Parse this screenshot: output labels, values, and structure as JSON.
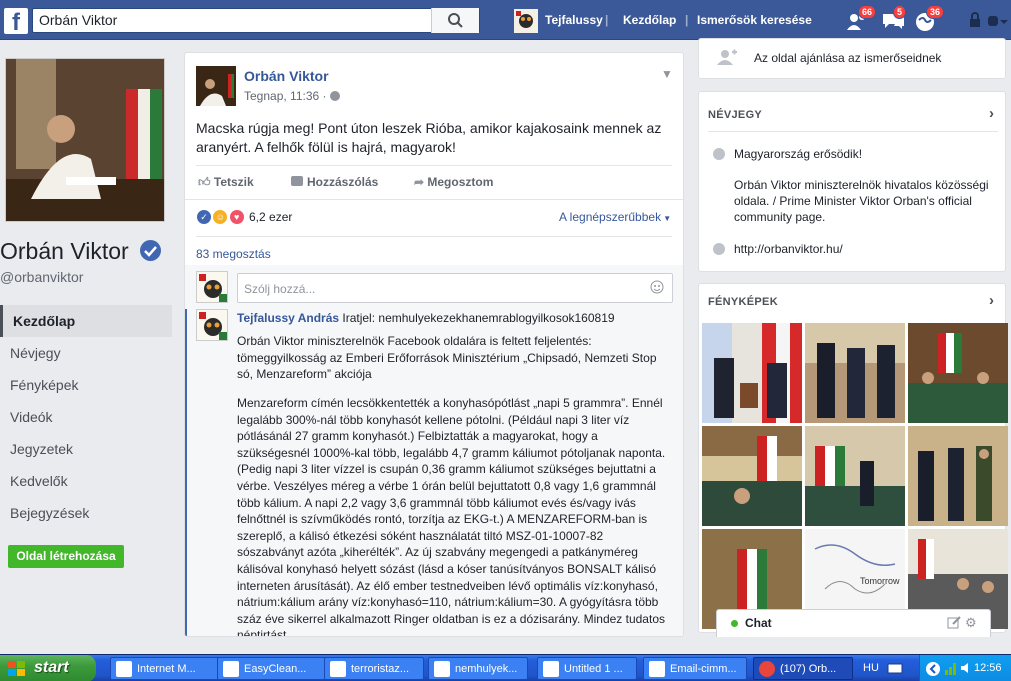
{
  "topbar": {
    "logo": "f",
    "search_value": "Orbán Viktor",
    "user_name": "Tejfalussy",
    "home": "Kezdőlap",
    "find_friends": "Ismerősök keresése",
    "friend_requests_count": "66",
    "messages_count": "5",
    "notifications_count": "36"
  },
  "profile": {
    "name": "Orbán Viktor",
    "handle": "@orbanviktor",
    "nav": [
      "Kezdőlap",
      "Névjegy",
      "Fényképek",
      "Videók",
      "Jegyzetek",
      "Kedvelők",
      "Bejegyzések"
    ],
    "create_page": "Oldal létrehozása"
  },
  "post": {
    "author": "Orbán Viktor",
    "time": "Tegnap, 11:36 · ",
    "text": "Macska rúgja meg! Pont úton leszek Rióba, amikor kajakosaink mennek az aranyért. A felhők fölül is hajrá, magyarok!",
    "actions": {
      "like": "Tetszik",
      "comment": "Hozzászólás",
      "share": "Megosztom"
    },
    "reaction_count": "6,2 ezer",
    "sort": "A legnépszerűbbek",
    "shares": "83 megosztás",
    "comment_placeholder": "Szólj hozzá...",
    "comment": {
      "author": "Tejfalussy András",
      "title": " Iratjel: nemhulyekezekhanemrablogyilkosok160819",
      "para1": "Orbán Viktor miniszterelnök Facebook oldalára is feltett feljelentés: tömeggyilkosság az Emberi Erőforrások Minisztérium „Chipsadó, Nemzeti Stop só, Menzareform” akciója",
      "para2": "Menzareform címén lecsökkentették a konyhasópótlást „napi 5 grammra”. Ennél legalább 300%-nál több konyhasót kellene pótolni. (Például napi 3 liter víz pótlásánál 27 gramm konyhasót.) Felbiztatták a magyarokat, hogy a szükségesnél 1000%-kal több, legalább 4,7 gramm káliumot pótoljanak naponta. (Pedig napi 3 liter vízzel is csupán 0,36 gramm káliumot szükséges bejuttatni a vérbe. Veszélyes méreg a vérbe 1 órán belül bejuttatott 0,8 vagy 1,6 grammnál több kálium. A napi 2,2 vagy 3,6 grammnál több káliumot evés és/vagy ivás felnőttnél is szívműködés rontó, torzítja az EKG-t.) A MENZAREFORM-ban is szereplő, a kálisó étkezési sóként használatát tiltó MSZ-01-10007-82 sószabványt azóta „kiherélték”. Az új szabvány megengedi a patkányméreg kálisóval konyhasó helyett sózást (lásd a kóser tanúsítványos BONSALT kálisó interneten árusítását). Az élő ember testnedveiben lévő optimális víz:konyhasó, nátrium:kálium arány víz:konyhasó=110, nátrium:kálium=30. A gyógyításra több száz éve sikerrel alkalmazott Ringer oldatban is ez a dózisarány. Mindez tudatos néptirtást"
    }
  },
  "sidebar": {
    "recommend": "Az oldal ajánlása az ismerőseidnek",
    "about_title": "NÉVJEGY",
    "about_tagline": "Magyarország erősödik!",
    "about_desc": "Orbán Viktor miniszterelnök hivatalos közösségi oldala. / Prime Minister Viktor Orban's official community page.",
    "about_url": "http://orbanviktor.hu/",
    "photos_title": "FÉNYKÉPEK"
  },
  "chat": {
    "label": "Chat"
  },
  "taskbar": {
    "start": "start",
    "tasks": [
      "Internet M...",
      "EasyClean...",
      "terroristaz...",
      "nemhulyek...",
      "Untitled 1 ...",
      "Email-cimm...",
      "(107) Orb..."
    ],
    "lang": "HU",
    "clock": "12:56"
  },
  "colors": {
    "facebook_blue": "#3b5998",
    "link_blue": "#365899",
    "green": "#42b72a",
    "badge_red": "#fa3e3e",
    "xp_blue": "#245edb"
  }
}
